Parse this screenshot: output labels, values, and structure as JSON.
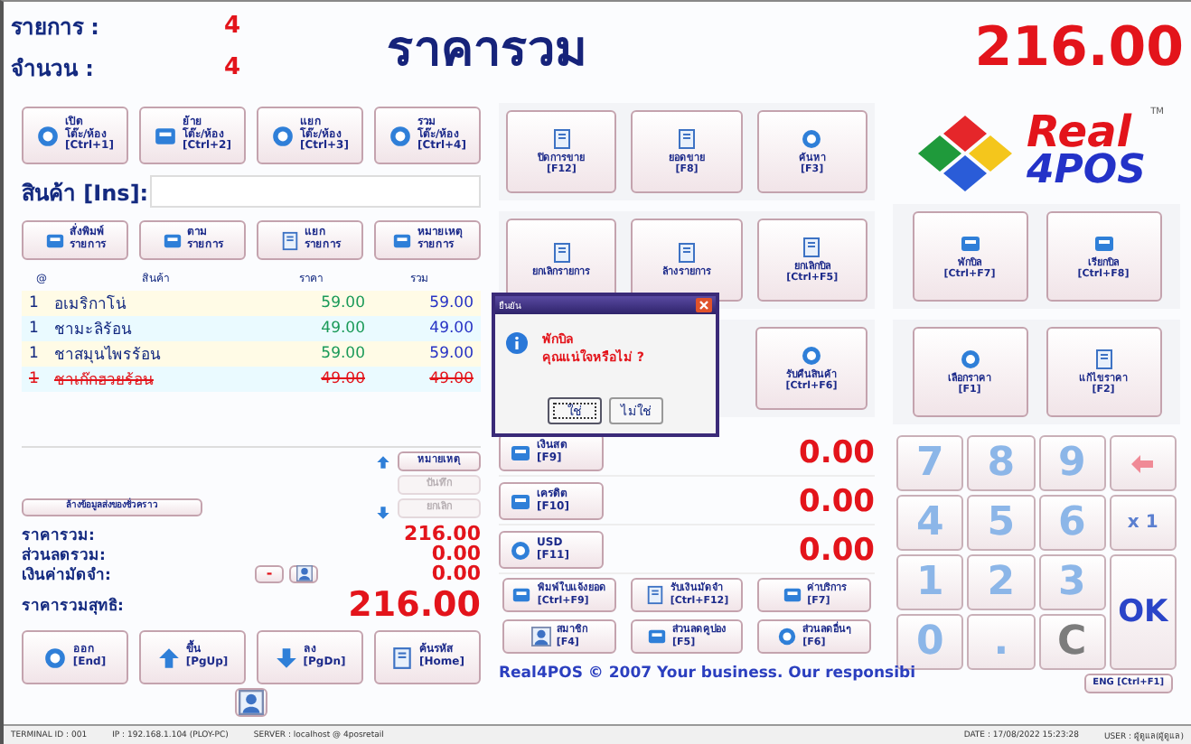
{
  "summary": [
    {
      "label": "รายการ :",
      "value": "4"
    },
    {
      "label": "จำนวน :",
      "value": "4"
    }
  ],
  "title": "ราคารวม",
  "grand_total": "216.00",
  "table_buttons": [
    {
      "lines": [
        "เปิด",
        "โต๊ะ/ห้อง",
        "[Ctrl+1]"
      ]
    },
    {
      "lines": [
        "ย้าย",
        "โต๊ะ/ห้อง",
        "[Ctrl+2]"
      ]
    },
    {
      "lines": [
        "แยก",
        "โต๊ะ/ห้อง",
        "[Ctrl+3]"
      ]
    },
    {
      "lines": [
        "รวม",
        "โต๊ะ/ห้อง",
        "[Ctrl+4]"
      ]
    }
  ],
  "product_field": {
    "label": "สินค้า [Ins]:"
  },
  "item_buttons": [
    {
      "lines": [
        "สั่งพิมพ์",
        "รายการ"
      ]
    },
    {
      "lines": [
        "ตาม",
        "รายการ"
      ]
    },
    {
      "lines": [
        "แยก",
        "รายการ"
      ]
    },
    {
      "lines": [
        "หมายเหตุ",
        "รายการ"
      ]
    }
  ],
  "order": {
    "columns": [
      "@",
      "สินค้า",
      "ราคา",
      "รวม"
    ],
    "rows": [
      {
        "qty": "1",
        "name": "อเมริกาโน่",
        "price": "59.00",
        "total": "59.00",
        "voided": false
      },
      {
        "qty": "1",
        "name": "ชามะลิร้อน",
        "price": "49.00",
        "total": "49.00",
        "voided": false
      },
      {
        "qty": "1",
        "name": "ชาสมุนไพรร้อน",
        "price": "59.00",
        "total": "59.00",
        "voided": false
      },
      {
        "qty": "1",
        "name": "ชาเก๊กฮวยร้อน",
        "price": "49.00",
        "total": "49.00",
        "voided": true
      }
    ]
  },
  "note_buttons": [
    {
      "label": "หมายเหตุ",
      "disabled": false
    },
    {
      "label": "บันทึก",
      "disabled": true
    },
    {
      "label": "ยกเลิก",
      "disabled": true
    }
  ],
  "clear_button": "ล้างข้อมูลส่งของชั่วคราว",
  "totals": [
    {
      "label": "ราคารวม:",
      "value": "216.00"
    },
    {
      "label": "ส่วนลดรวม:",
      "value": "0.00"
    },
    {
      "label": "เงินค่ามัดจำ:",
      "value": "0.00"
    }
  ],
  "deposit_minus": "-",
  "net": {
    "label": "ราคารวมสุทธิ:",
    "value": "216.00"
  },
  "nav_buttons": [
    {
      "lines": [
        "ออก",
        "[End]"
      ]
    },
    {
      "lines": [
        "ขึ้น",
        "[PgUp]"
      ]
    },
    {
      "lines": [
        "ลง",
        "[PgDn]"
      ]
    },
    {
      "lines": [
        "ค้นรหัส",
        "[Home]"
      ]
    }
  ],
  "function_rows": [
    [
      {
        "lines": [
          "ปิดการขาย",
          "[F12]"
        ]
      },
      {
        "lines": [
          "ยอดขาย",
          "[F8]"
        ]
      },
      {
        "lines": [
          "ค้นหา",
          "[F3]"
        ]
      }
    ],
    [
      {
        "lines": [
          "ยกเลิกรายการ"
        ]
      },
      {
        "lines": [
          "ล้างรายการ"
        ]
      },
      {
        "lines": [
          "ยกเลิกบิล",
          "[Ctrl+F5]"
        ]
      }
    ],
    [
      {
        "lines": [
          "รับคืนสินค้า",
          "[Ctrl+F6]"
        ]
      }
    ]
  ],
  "dialog": {
    "title": "ยืนยัน",
    "lines": [
      "พักบิล",
      "คุณแน่ใจหรือไม่ ?"
    ],
    "buttons": [
      {
        "label": "ใช่",
        "selected": true
      },
      {
        "label": "ไม่ใช่",
        "selected": false
      }
    ]
  },
  "payments": [
    {
      "label": "เงินสด",
      "key": "[F9]",
      "amount": "0.00"
    },
    {
      "label": "เครดิต",
      "key": "[F10]",
      "amount": "0.00"
    },
    {
      "label": "USD",
      "key": "[F11]",
      "amount": "0.00"
    }
  ],
  "extra_buttons": [
    {
      "lines": [
        "พิมพ์ใบแจ้งยอด",
        "[Ctrl+F9]"
      ]
    },
    {
      "lines": [
        "รับเงินมัดจำ",
        "[Ctrl+F12]"
      ]
    },
    {
      "lines": [
        "ค่าบริการ",
        "[F7]"
      ]
    },
    {
      "lines": [
        "สมาชิก",
        "[F4]"
      ]
    },
    {
      "lines": [
        "ส่วนลดคูปอง",
        "[F5]"
      ]
    },
    {
      "lines": [
        "ส่วนลดอื่นๆ",
        "[F6]"
      ]
    }
  ],
  "footer_text": "Real4POS © 2007 Your business. Our responsibi",
  "logo": {
    "word1": "Real",
    "word2": "4POS",
    "mark": "TM"
  },
  "bill_rows": [
    [
      {
        "lines": [
          "พักบิล",
          "[Ctrl+F7]"
        ]
      },
      {
        "lines": [
          "เรียกบิล",
          "[Ctrl+F8]"
        ]
      }
    ],
    [
      {
        "lines": [
          "เลือกราคา",
          "[F1]"
        ]
      },
      {
        "lines": [
          "แก้ไขราคา",
          "[F2]"
        ]
      }
    ]
  ],
  "keypad": [
    {
      "kind": "digit",
      "label": "7"
    },
    {
      "kind": "digit",
      "label": "8"
    },
    {
      "kind": "digit",
      "label": "9"
    },
    {
      "kind": "backspace"
    },
    {
      "kind": "digit",
      "label": "4"
    },
    {
      "kind": "digit",
      "label": "5"
    },
    {
      "kind": "digit",
      "label": "6"
    },
    {
      "kind": "multiplier",
      "label": "x 1"
    },
    {
      "kind": "digit",
      "label": "1"
    },
    {
      "kind": "digit",
      "label": "2"
    },
    {
      "kind": "digit",
      "label": "3"
    },
    {
      "kind": "ok",
      "label": "OK"
    },
    {
      "kind": "digit",
      "label": "0"
    },
    {
      "kind": "digit",
      "label": "."
    },
    {
      "kind": "clear",
      "label": "C"
    }
  ],
  "lang_button": "ENG [Ctrl+F1]",
  "status_bar": {
    "left": [
      "TERMINAL ID : 001",
      "IP : 192.168.1.104 (PLOY-PC)",
      "SERVER : localhost @ 4posretail"
    ],
    "right": [
      "DATE : 17/08/2022 15:23:28",
      "USER : ผู้ดูแล(ผู้ดูแล)"
    ]
  }
}
